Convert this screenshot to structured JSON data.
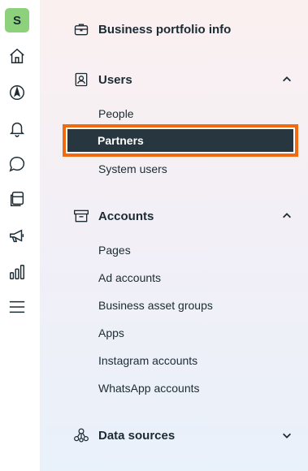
{
  "rail": {
    "avatar_letter": "S",
    "icons": [
      "home-icon",
      "compass-icon",
      "bell-icon",
      "chat-icon",
      "pages-icon",
      "megaphone-icon",
      "bar-chart-icon",
      "menu-icon"
    ]
  },
  "nav": {
    "business_info": "Business portfolio info",
    "users": {
      "label": "Users",
      "items": [
        "People",
        "Partners",
        "System users"
      ],
      "active": "Partners"
    },
    "accounts": {
      "label": "Accounts",
      "items": [
        "Pages",
        "Ad accounts",
        "Business asset groups",
        "Apps",
        "Instagram accounts",
        "WhatsApp accounts"
      ]
    },
    "data_sources": {
      "label": "Data sources"
    }
  },
  "colors": {
    "avatar": "#8ed17c",
    "active_bg": "#283640",
    "highlight_border": "#f26a10",
    "text": "#1c2b33"
  }
}
